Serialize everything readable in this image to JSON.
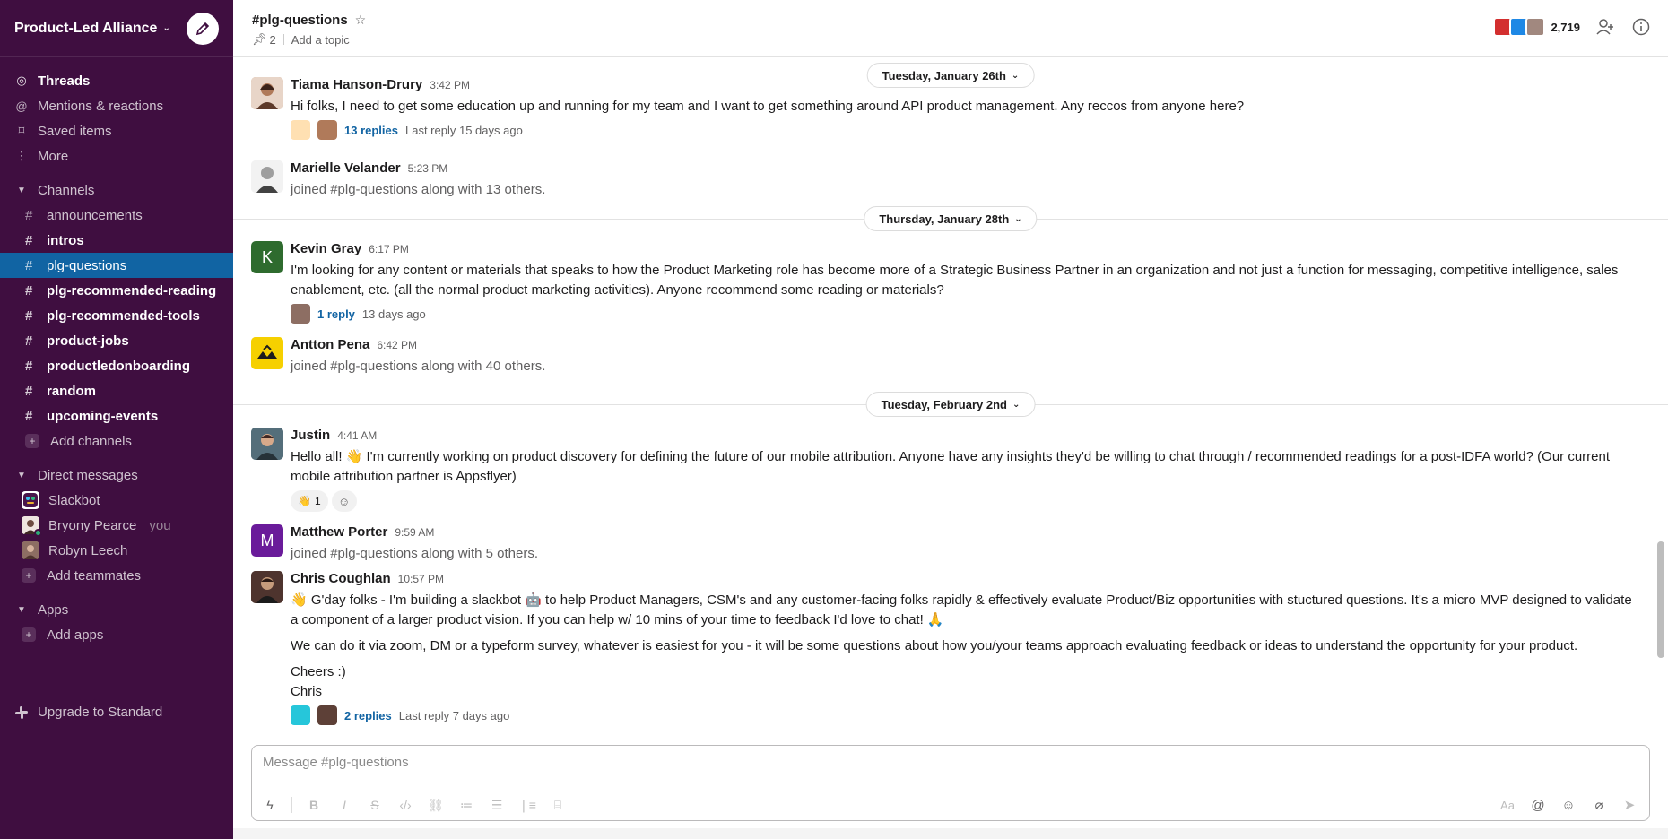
{
  "workspace": {
    "name": "Product-Led Alliance"
  },
  "nav": [
    {
      "label": "Threads",
      "icon": "threads-icon",
      "glyph": "◎"
    },
    {
      "label": "Mentions & reactions",
      "icon": "at-icon",
      "glyph": "@"
    },
    {
      "label": "Saved items",
      "icon": "bookmark-icon",
      "glyph": "⌑"
    },
    {
      "label": "More",
      "icon": "more-icon",
      "glyph": "⋮"
    }
  ],
  "channels_section": {
    "label": "Channels"
  },
  "channels": [
    {
      "name": "announcements",
      "state": "normal"
    },
    {
      "name": "intros",
      "state": "unread"
    },
    {
      "name": "plg-questions",
      "state": "active"
    },
    {
      "name": "plg-recommended-reading",
      "state": "unread"
    },
    {
      "name": "plg-recommended-tools",
      "state": "unread"
    },
    {
      "name": "product-jobs",
      "state": "unread"
    },
    {
      "name": "productledonboarding",
      "state": "unread"
    },
    {
      "name": "random",
      "state": "unread"
    },
    {
      "name": "upcoming-events",
      "state": "unread"
    }
  ],
  "add_channels": "Add channels",
  "dm_section": {
    "label": "Direct messages"
  },
  "dms": [
    {
      "name": "Slackbot",
      "you": "",
      "color": "#e01e5a"
    },
    {
      "name": "Bryony Pearce",
      "you": "you",
      "color": "#8d6e63"
    },
    {
      "name": "Robyn Leech",
      "you": "",
      "color": "#6d4c41"
    }
  ],
  "add_teammates": "Add teammates",
  "apps_section": {
    "label": "Apps"
  },
  "add_apps": "Add apps",
  "upgrade": "Upgrade to Standard",
  "header": {
    "channel": "#plg-questions",
    "pins": "2",
    "topic": "Add a topic",
    "member_count": "2,719"
  },
  "dates": {
    "d1": "Tuesday, January 26th",
    "d2": "Thursday, January 28th",
    "d3": "Tuesday, February 2nd"
  },
  "messages": {
    "m1": {
      "author": "Tiama Hanson-Drury",
      "time": "3:42 PM",
      "text": "Hi folks, I need to get some education up and running for my team and I want to get something around API product management. Any reccos from anyone here?",
      "replies": "13 replies",
      "last": "Last reply 15 days ago"
    },
    "m2": {
      "author": "Marielle Velander",
      "time": "5:23 PM",
      "text": "joined #plg-questions along with 13 others."
    },
    "m3": {
      "author": "Kevin Gray",
      "initial": "K",
      "time": "6:17 PM",
      "text": "I'm looking for any content or materials that speaks to how the Product Marketing role has become more of a Strategic Business Partner in an organization and not just a function for messaging, competitive intelligence, sales enablement, etc. (all the normal product marketing activities).  Anyone recommend some reading or materials?",
      "replies": "1 reply",
      "last": "13 days ago"
    },
    "m4": {
      "author": "Antton Pena",
      "time": "6:42 PM",
      "text": "joined #plg-questions along with 40 others."
    },
    "m5": {
      "author": "Justin",
      "time": "4:41 AM",
      "text_a": "Hello all! ",
      "emoji": "👋",
      "text_b": " I'm currently working on product discovery for defining the future of our mobile attribution. Anyone have any insights they'd be willing to chat through / recommended readings for a post-IDFA world? (Our current mobile attribution partner is Appsflyer)",
      "reaction_emoji": "👋",
      "reaction_count": "1"
    },
    "m6": {
      "author": "Matthew Porter",
      "initial": "M",
      "time": "9:59 AM",
      "text": "joined #plg-questions along with 5 others."
    },
    "m7": {
      "author": "Chris Coughlan",
      "time": "10:57 PM",
      "emoji_start": "👋",
      "text_a": " G'day folks - I'm building a slackbot ",
      "emoji_bot": "🤖",
      "text_b": " to help Product Managers, CSM's and any customer-facing folks rapidly & effectively evaluate Product/Biz opportunities with stuctured questions. It's a micro MVP designed to validate a component of a larger product vision. If you can help w/ 10 mins of your time to feedback I'd love to chat! ",
      "emoji_end": "🙏",
      "para2": "We can do it via zoom, DM or a typeform survey, whatever is easiest for you - it will be some questions about how you/your teams approach evaluating feedback or ideas to understand the opportunity for your product.",
      "para3a": "Cheers :)",
      "para3b": "Chris",
      "replies": "2 replies",
      "last": "Last reply 7 days ago"
    }
  },
  "composer": {
    "placeholder": "Message #plg-questions"
  }
}
